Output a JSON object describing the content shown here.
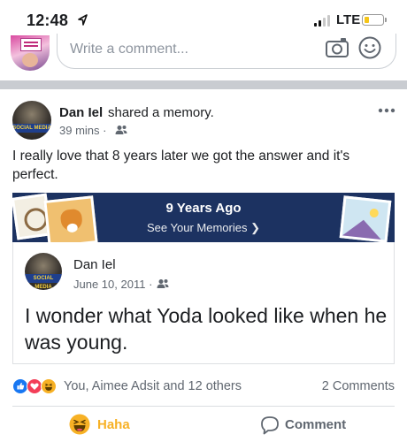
{
  "status_bar": {
    "time": "12:48",
    "network": "LTE",
    "battery_color": "#f5c518"
  },
  "composer": {
    "placeholder": "Write a comment...",
    "icons": [
      "camera-icon",
      "smile-icon"
    ]
  },
  "post": {
    "author": "Dan Iel",
    "action": "shared a memory.",
    "time": "39 mins",
    "privacy_icon": "friends-icon",
    "text": "I really love that 8 years later we got the answer and it's perfect.",
    "memory_banner": {
      "title": "9 Years Ago",
      "link": "See Your Memories ❯",
      "color": "#1c3261"
    },
    "shared": {
      "author": "Dan Iel",
      "date": "June 10, 2011",
      "text": "I wonder what Yoda looked like when he was young."
    },
    "reactions": {
      "icons": [
        "like-icon",
        "love-icon",
        "haha-icon"
      ],
      "summary": "You, Aimee Adsit and 12 others",
      "comments": "2 Comments"
    },
    "actions": {
      "haha": "Haha",
      "comment": "Comment"
    }
  },
  "colors": {
    "brand_blue": "#1877f2",
    "love_red": "#f33e58",
    "haha_yellow": "#f7b125",
    "secondary_text": "#606770"
  }
}
